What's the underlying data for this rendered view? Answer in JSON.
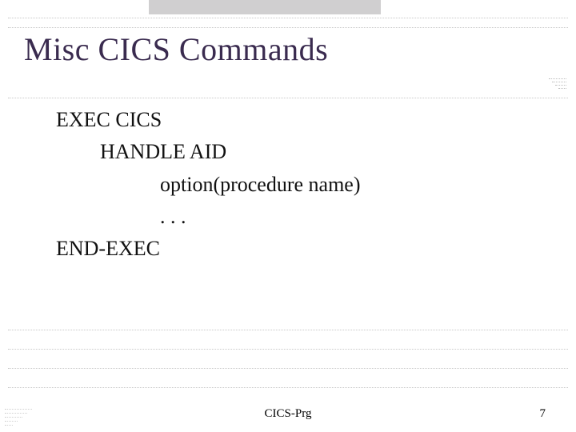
{
  "title": "Misc CICS Commands",
  "code": {
    "line1": "EXEC CICS",
    "line2": "HANDLE AID",
    "line3": "option(procedure name)",
    "line4": ". . .",
    "line5": "END-EXEC"
  },
  "footer": {
    "center": "CICS-Prg",
    "page": "7"
  },
  "ruleYs": [
    22,
    34,
    122,
    412,
    436,
    460,
    484
  ],
  "wedgeWidths": [
    22,
    18,
    14,
    10
  ],
  "blDecoWidths": [
    10,
    16,
    22,
    28,
    34
  ]
}
